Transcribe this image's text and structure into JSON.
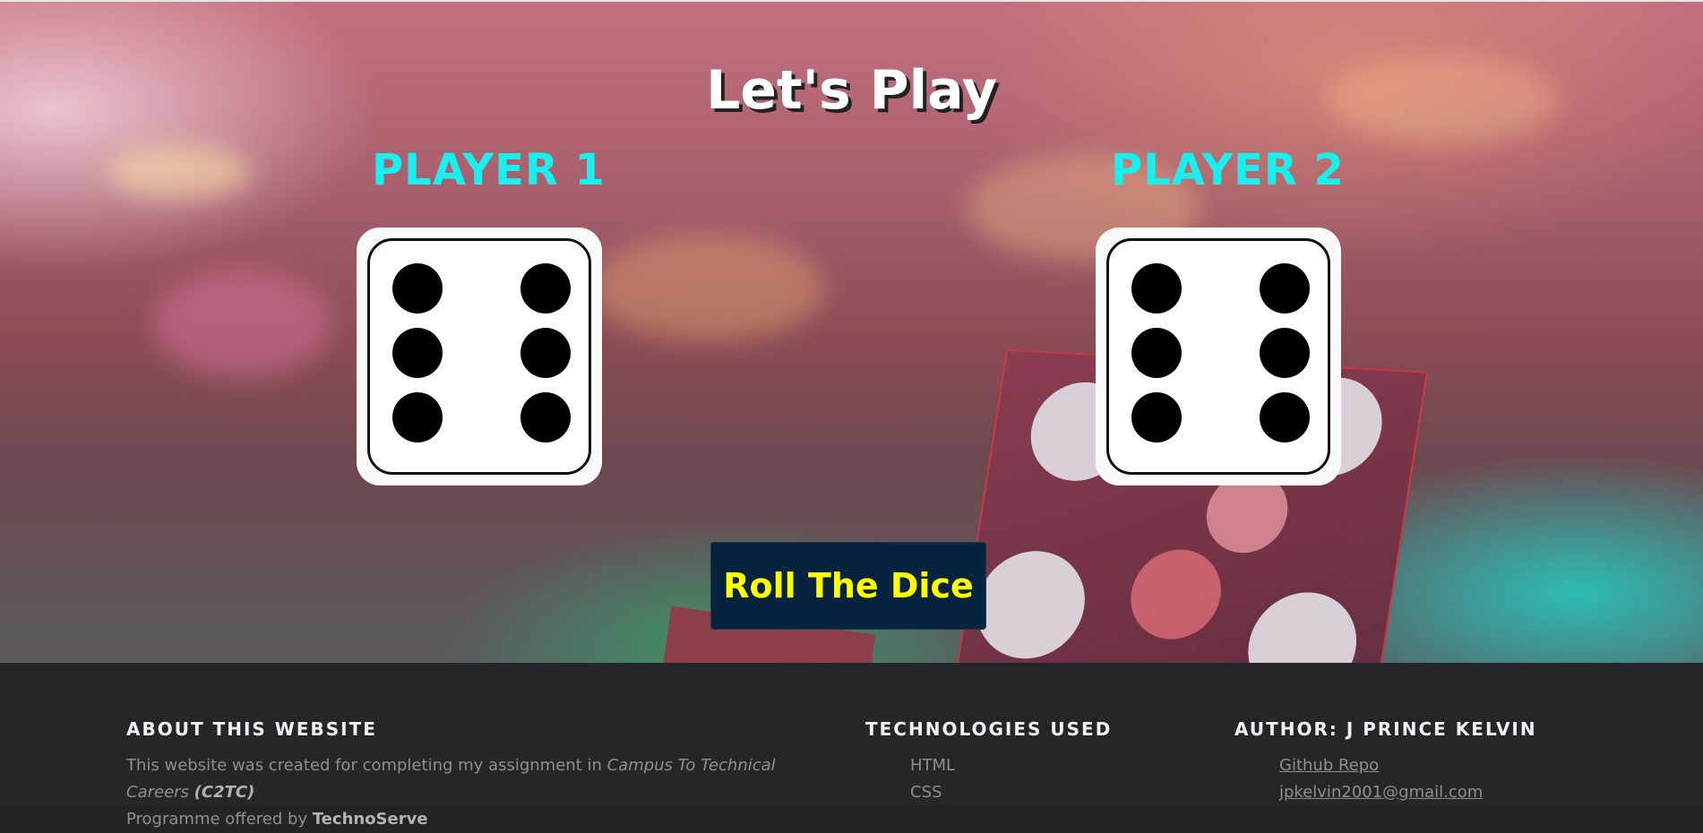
{
  "game": {
    "heading": "Let's Play",
    "player1_label": "PLAYER 1",
    "player2_label": "PLAYER 2",
    "player1_die_value": 6,
    "player2_die_value": 6,
    "roll_button_label": "Roll The Dice",
    "colors": {
      "player_label": "#1aefef",
      "button_bg": "#08233d",
      "button_text": "#ffff00"
    }
  },
  "footer": {
    "about": {
      "heading": "ABOUT THIS WEBSITE",
      "text_1": "This website was created for completing my assignment in ",
      "text_italic": "Campus To Technical Careers",
      "text_bold_italic": "(C2TC)",
      "text_2": "Programme offered by ",
      "text_bold": "TechnoServe"
    },
    "technologies": {
      "heading": "TECHNOLOGIES USED",
      "items": [
        "HTML",
        "CSS"
      ]
    },
    "author": {
      "heading": "AUTHOR: J PRINCE KELVIN",
      "links": [
        "Github Repo",
        "jpkelvin2001@gmail.com"
      ]
    }
  }
}
